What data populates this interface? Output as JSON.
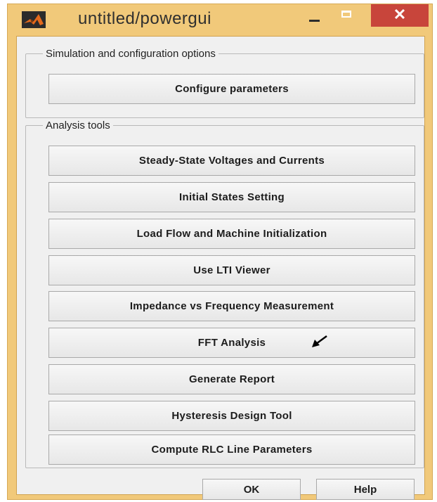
{
  "window": {
    "title": "untitled/powergui",
    "app_icon": "matlab-logo-icon",
    "controls": {
      "minimize_icon": "minimize-icon",
      "maximize_icon": "maximize-icon",
      "close_label": "✕"
    },
    "frame_color": "#f1c97a",
    "close_color": "#c8453b"
  },
  "simulation_group": {
    "legend": "Simulation and configuration options",
    "button": "Configure parameters"
  },
  "analysis_group": {
    "legend": "Analysis tools",
    "buttons": [
      "Steady-State Voltages and Currents",
      "Initial States Setting",
      "Load Flow and Machine Initialization",
      "Use LTI Viewer",
      "Impedance vs Frequency Measurement",
      "FFT Analysis",
      "Generate Report",
      "Hysteresis Design Tool",
      "Compute RLC  Line Parameters"
    ]
  },
  "footer": {
    "ok_label": "OK",
    "help_label": "Help"
  },
  "annotation": {
    "arrow_icon": "pointer-arrow-icon"
  }
}
